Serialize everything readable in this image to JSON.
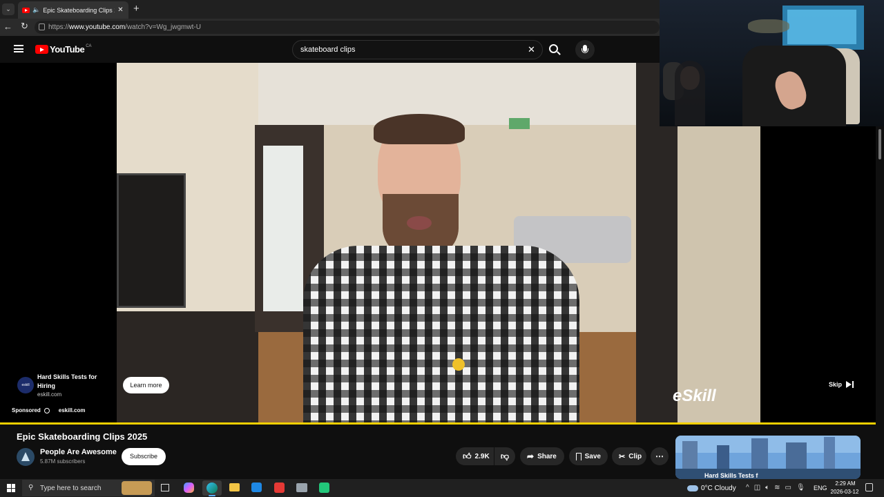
{
  "browser": {
    "tab_title": "Epic Skateboarding Clips 2025",
    "url_prefix": "https://",
    "url_host": "www.youtube.com",
    "url_path": "/watch?v=Wg_jwgmwt-U"
  },
  "youtube": {
    "logo": "YouTube",
    "region": "CA",
    "search_value": "skateboard clips"
  },
  "ad": {
    "advertiser_initials": "eskill",
    "headline": "Hard Skills Tests for Hiring",
    "domain": "eskill.com",
    "learn_more": "Learn more",
    "sponsored": "Sponsored",
    "sponsor_domain": "eskill.com",
    "skip": "Skip",
    "watermark": "eSkill"
  },
  "video": {
    "title": "Epic Skateboarding Clips 2025",
    "channel": "People Are Awesome",
    "subscribers": "5.87M subscribers",
    "subscribe": "Subscribe",
    "likes": "2.9K",
    "share": "Share",
    "save": "Save",
    "clip": "Clip",
    "side_ad_text": "Hard Skills Tests f"
  },
  "taskbar": {
    "search_placeholder": "Type here to search",
    "weather": "0°C  Cloudy",
    "language": "ENG",
    "time": "2:29 AM",
    "date": "2026-03-12"
  },
  "colors": {
    "progress": "#f5d000",
    "yt_red": "#ff0000",
    "background": "#0f0f0f"
  }
}
